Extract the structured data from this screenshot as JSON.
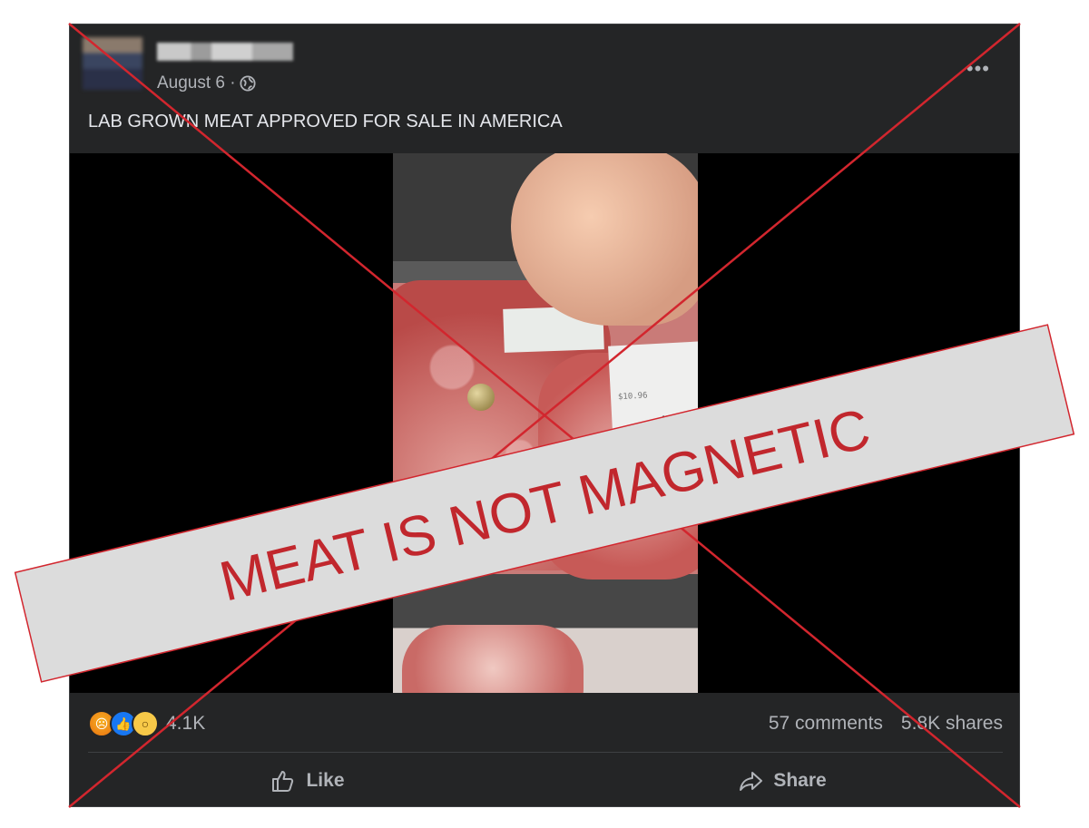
{
  "post": {
    "date": "August 6 ·",
    "more_label": "•••",
    "caption": "LAB GROWN MEAT APPROVED FOR SALE IN AMERICA"
  },
  "video": {
    "price_text": "$10.96"
  },
  "stats": {
    "reaction_count": "4.1K",
    "comments": "57 comments",
    "shares": "5.8K shares",
    "reaction_icons": [
      "angry-reaction-icon",
      "like-reaction-icon",
      "wow-reaction-icon"
    ]
  },
  "actions": {
    "like_label": "Like",
    "share_label": "Share"
  },
  "overlay": {
    "banner_text": "MEAT IS NOT MAGNETIC",
    "accent_color": "#c1272d"
  }
}
